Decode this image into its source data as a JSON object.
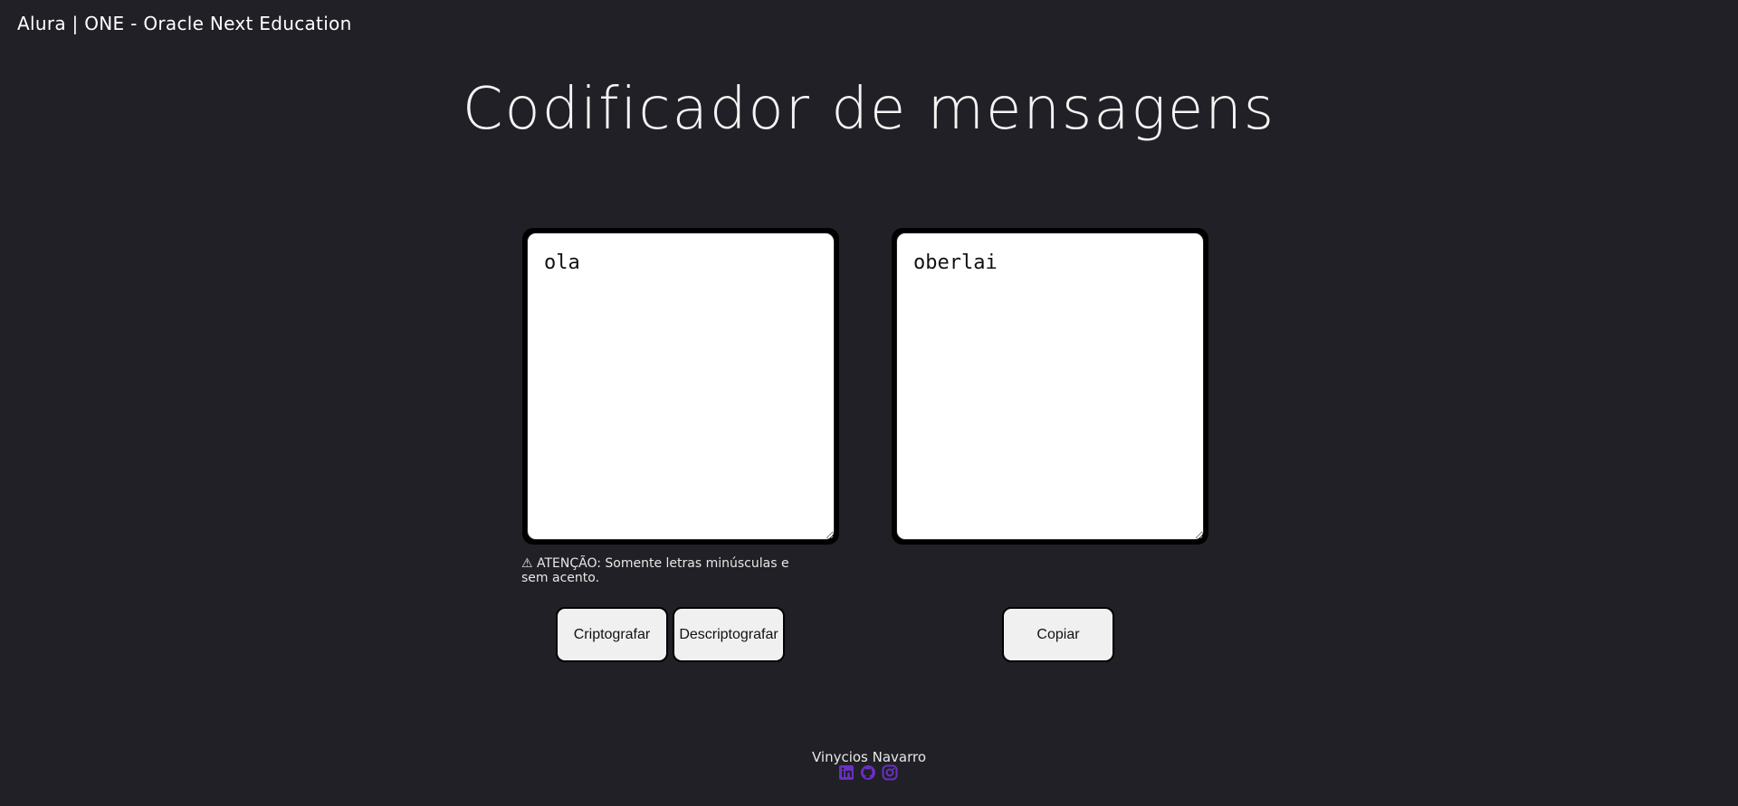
{
  "header": {
    "brand": "Alura | ONE - Oracle Next Education"
  },
  "main": {
    "title": "Codificador de mensagens",
    "input": {
      "value": "ola"
    },
    "output": {
      "value": "oberlai"
    },
    "warning": "⚠ ATENÇÃO: Somente letras minúsculas e sem acento.",
    "buttons": {
      "encrypt": "Criptografar",
      "decrypt": "Descriptografar",
      "copy": "Copiar"
    }
  },
  "footer": {
    "author": "Vinycios Navarro",
    "icons": [
      "linkedin-icon",
      "github-icon",
      "instagram-icon"
    ],
    "icon_color": "#6b2fc2"
  },
  "colors": {
    "background": "#202026",
    "text": "#f2f2f2",
    "button": "#f0f0f0"
  }
}
